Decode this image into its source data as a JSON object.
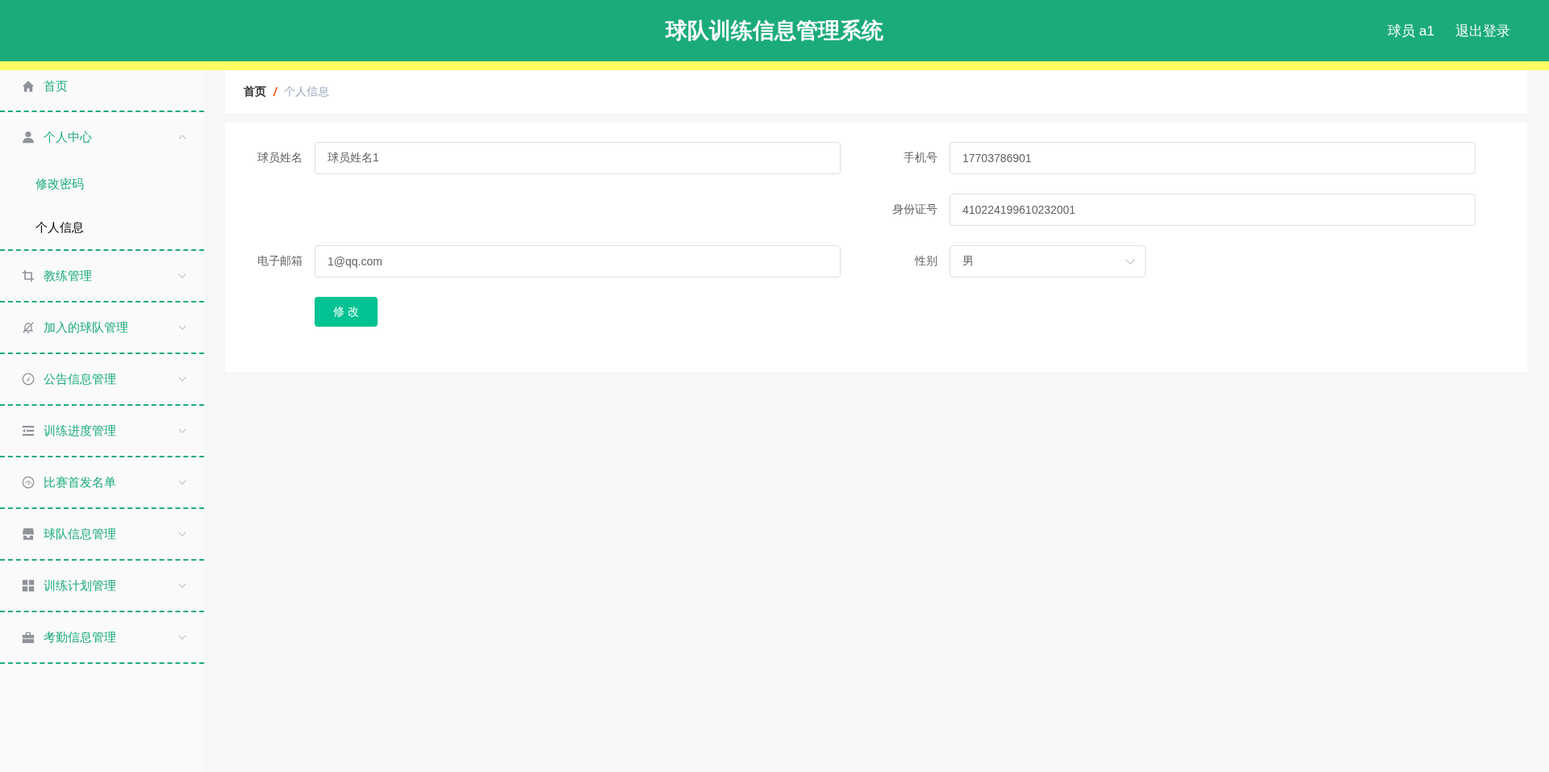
{
  "header": {
    "title": "球队训练信息管理系统",
    "user": "球员 a1",
    "logout": "退出登录"
  },
  "sidebar": {
    "items": [
      {
        "kind": "link",
        "label": "首页",
        "selected": false
      },
      {
        "kind": "submenu",
        "label": "个人中心",
        "expanded": true,
        "children": [
          {
            "label": "修改密码",
            "selected": false
          },
          {
            "label": "个人信息",
            "selected": true
          }
        ]
      },
      {
        "kind": "submenu",
        "label": "教练管理",
        "expanded": false
      },
      {
        "kind": "submenu",
        "label": "加入的球队管理",
        "expanded": false
      },
      {
        "kind": "submenu",
        "label": "公告信息管理",
        "expanded": false
      },
      {
        "kind": "submenu",
        "label": "训练进度管理",
        "expanded": false
      },
      {
        "kind": "submenu",
        "label": "比赛首发名单",
        "expanded": false
      },
      {
        "kind": "submenu",
        "label": "球队信息管理",
        "expanded": false
      },
      {
        "kind": "submenu",
        "label": "训练计划管理",
        "expanded": false
      },
      {
        "kind": "submenu",
        "label": "考勤信息管理",
        "expanded": false
      }
    ]
  },
  "breadcrumb": {
    "items": [
      {
        "label": "首页",
        "current": false
      },
      {
        "label": "个人信息",
        "current": true
      }
    ],
    "separator": "/"
  },
  "form": {
    "rows": [
      {
        "left": {
          "kind": "input",
          "label": "球员姓名",
          "value": "球员姓名1"
        },
        "right": {
          "kind": "input",
          "label": "手机号",
          "value": "17703786901"
        }
      },
      {
        "right": {
          "kind": "input",
          "label": "身份证号",
          "value": "410224199610232001"
        }
      },
      {
        "left": {
          "kind": "input",
          "label": "电子邮箱",
          "value": "1@qq.com"
        },
        "right": {
          "kind": "select",
          "label": "性别",
          "value": "男"
        }
      }
    ],
    "submit": "修 改"
  }
}
